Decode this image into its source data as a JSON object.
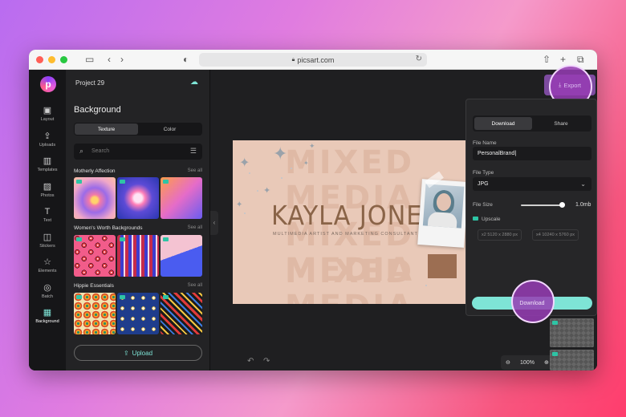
{
  "browser": {
    "url": "picsart.com",
    "icons": [
      "sidebar-icon",
      "back-icon",
      "forward-icon",
      "shield-icon",
      "reload-icon",
      "share-icon",
      "new-tab-icon",
      "tabs-icon"
    ]
  },
  "app": {
    "logo_letter": "p",
    "project_title": "Project 29",
    "export_label": "Export"
  },
  "rail": {
    "items": [
      {
        "label": "Layout",
        "icon": "layout-icon"
      },
      {
        "label": "Uploads",
        "icon": "upload-icon"
      },
      {
        "label": "Templates",
        "icon": "book-icon"
      },
      {
        "label": "Photos",
        "icon": "image-icon"
      },
      {
        "label": "Text",
        "icon": "text-icon"
      },
      {
        "label": "Stickers",
        "icon": "sticker-icon"
      },
      {
        "label": "Elements",
        "icon": "star-icon"
      },
      {
        "label": "Batch",
        "icon": "batch-icon"
      },
      {
        "label": "Background",
        "icon": "background-icon",
        "active": true
      }
    ]
  },
  "panel": {
    "title": "Background",
    "tabs": [
      "Texture",
      "Color"
    ],
    "search_placeholder": "Search",
    "sections": [
      {
        "title": "Motherly Affection",
        "see_all": "See all"
      },
      {
        "title": "Women's Worth Backgrounds",
        "see_all": "See all"
      },
      {
        "title": "Hippie Essentials",
        "see_all": "See all"
      }
    ],
    "upload_label": "Upload"
  },
  "canvas": {
    "bg_word": "MIXED MEDIA",
    "name": "KAYLA JONES",
    "subtitle": "MULTIMEDIA ARTIST AND MARKETING CONSULTANT",
    "zoom": "100%"
  },
  "export_panel": {
    "tabs": [
      "Download",
      "Share"
    ],
    "file_name_label": "File Name",
    "file_name_value": "PersonalBrand",
    "file_type_label": "File Type",
    "file_type_value": "JPG",
    "file_size_label": "File Size",
    "file_size_value": "1.0mb",
    "file_size_level": 1.0,
    "upscale_label": "Upscale",
    "upscale_options": [
      {
        "factor": "x2",
        "size": "5120 x 2880 px"
      },
      {
        "factor": "x4",
        "size": "10240 x 5760 px"
      }
    ],
    "download_label": "Download"
  },
  "colors": {
    "accent": "#7ee4d6",
    "highlight": "#9a3cb4",
    "canvas_bg": "#e9c9b8",
    "name_text": "#8a6448"
  }
}
